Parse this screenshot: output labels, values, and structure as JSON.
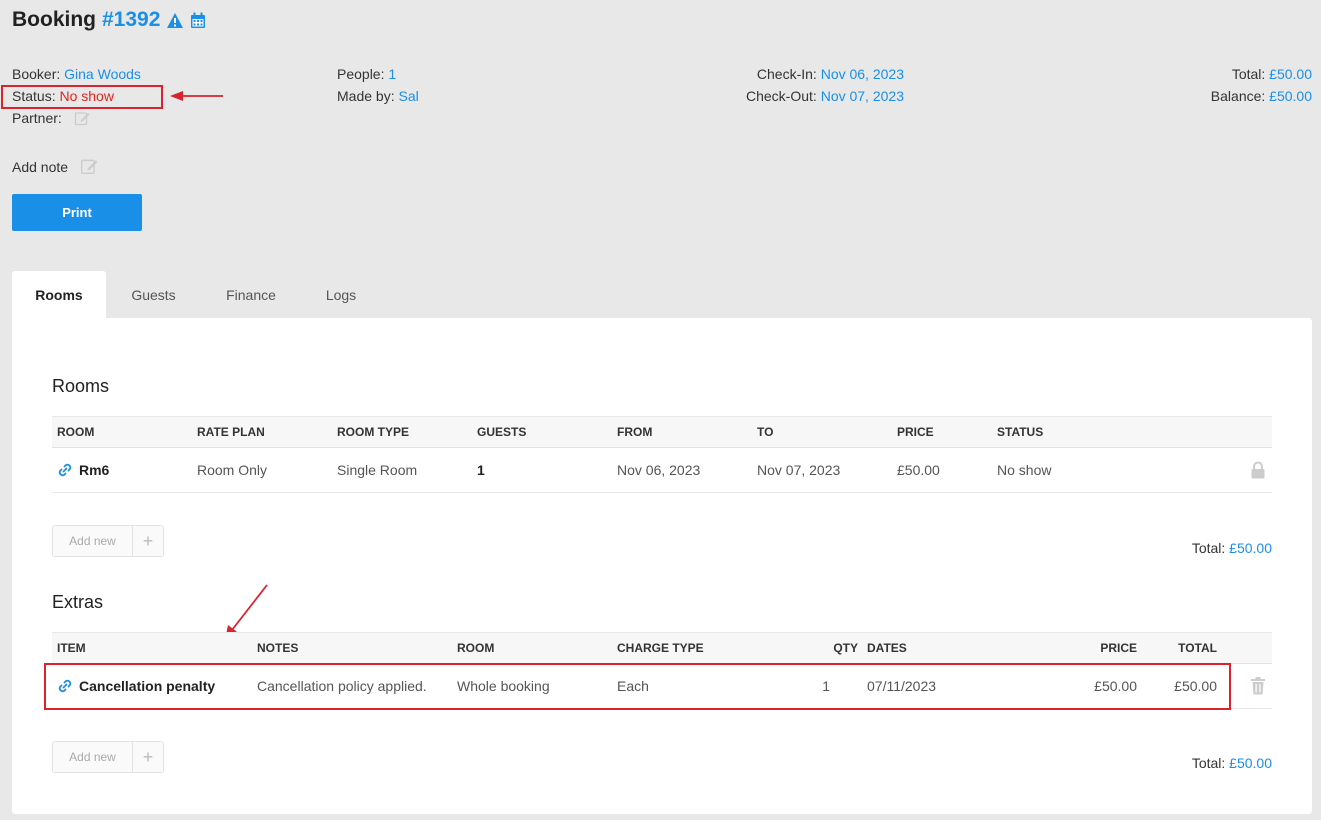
{
  "header": {
    "title_prefix": "Booking",
    "booking_number": "#1392"
  },
  "info": {
    "booker_label": "Booker:",
    "booker_value": "Gina Woods",
    "status_label": "Status:",
    "status_value": "No show",
    "partner_label": "Partner:",
    "people_label": "People:",
    "people_value": "1",
    "made_by_label": "Made by:",
    "made_by_value": "Sal",
    "checkin_label": "Check-In:",
    "checkin_value": "Nov 06, 2023",
    "checkout_label": "Check-Out:",
    "checkout_value": "Nov 07, 2023",
    "total_label": "Total:",
    "total_value": "£50.00",
    "balance_label": "Balance:",
    "balance_value": "£50.00"
  },
  "add_note_label": "Add note",
  "print_label": "Print",
  "tabs": [
    "Rooms",
    "Guests",
    "Finance",
    "Logs"
  ],
  "rooms": {
    "title": "Rooms",
    "headers": [
      "ROOM",
      "RATE PLAN",
      "ROOM TYPE",
      "GUESTS",
      "FROM",
      "TO",
      "PRICE",
      "STATUS"
    ],
    "rows": [
      {
        "room": "Rm6",
        "rate_plan": "Room Only",
        "room_type": "Single Room",
        "guests": "1",
        "from": "Nov 06, 2023",
        "to": "Nov 07, 2023",
        "price": "£50.00",
        "status": "No show"
      }
    ],
    "add_new_label": "Add new",
    "total_label": "Total:",
    "total_value": "£50.00"
  },
  "extras": {
    "title": "Extras",
    "headers": [
      "ITEM",
      "NOTES",
      "ROOM",
      "CHARGE TYPE",
      "QTY",
      "DATES",
      "PRICE",
      "TOTAL"
    ],
    "rows": [
      {
        "item": "Cancellation penalty",
        "notes": "Cancellation policy applied.",
        "room": "Whole booking",
        "charge_type": "Each",
        "qty": "1",
        "dates": "07/11/2023",
        "price": "£50.00",
        "total": "£50.00"
      }
    ],
    "add_new_label": "Add new",
    "total_label": "Total:",
    "total_value": "£50.00"
  },
  "colors": {
    "accent": "#1a8fe8",
    "alert": "#e0261b",
    "annotation": "#d9232e"
  },
  "icons": [
    "warning-icon",
    "calendar-icon",
    "edit-icon",
    "link-icon",
    "lock-icon",
    "trash-icon",
    "plus-icon",
    "arrow-annotation"
  ]
}
